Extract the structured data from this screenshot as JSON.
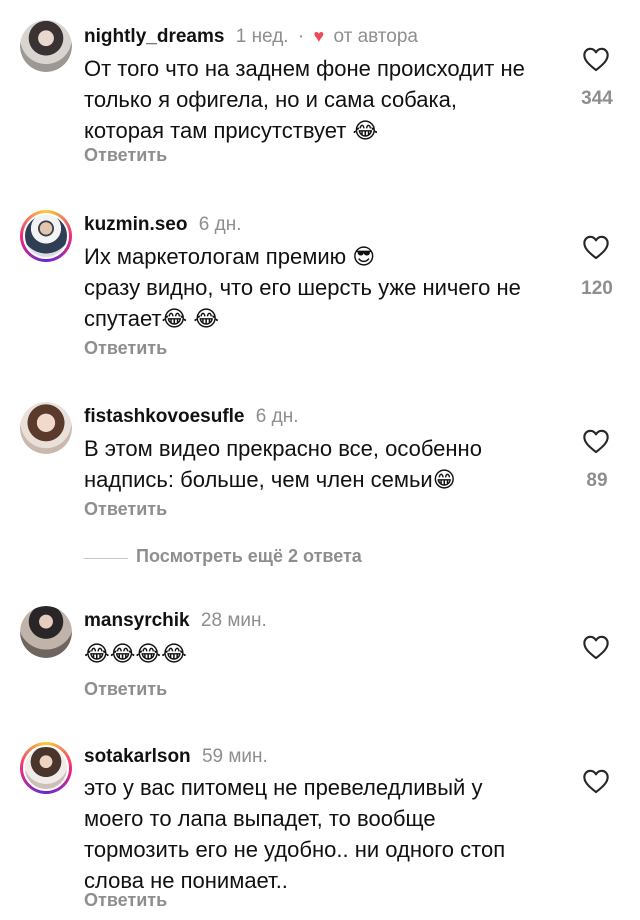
{
  "comments": [
    {
      "username": "nightly_dreams",
      "time": "1 нед.",
      "liked_by_author_label": "от автора",
      "text": "От того что на заднем фоне происходит не\nтолько я офигела, но и сама собака,\nкоторая там присутствует 😂",
      "reply_label": "Ответить",
      "likes": "344"
    },
    {
      "username": "kuzmin.seo",
      "time": "6 дн.",
      "text": "Их маркетологам премию 😎\nсразу видно, что его шерсть уже ничего не\nспутает😂 😂",
      "reply_label": "Ответить",
      "likes": "120"
    },
    {
      "username": "fistashkovoesufle",
      "time": "6 дн.",
      "text": "В этом видео прекрасно все, особенно\nнадпись: больше, чем член семьи😁",
      "reply_label": "Ответить",
      "likes": "89"
    },
    {
      "username": "mansyrchik",
      "time": "28 мин.",
      "text": "😂😂😂😂",
      "reply_label": "Ответить",
      "likes": ""
    },
    {
      "username": "sotakarlson",
      "time": "59 мин.",
      "text": "это у вас питомец не превеледливый у\nмоего то лапа выпадет, то вообще\nтормозить его не удобно.. ни одного стоп\nслова не понимает..",
      "reply_label": "Ответить",
      "likes": ""
    }
  ],
  "view_more_replies": "Посмотреть ещё 2 ответа",
  "colors": {
    "text": "#111111",
    "secondary": "#8e8e8e",
    "heart_red": "#ed4956"
  },
  "icons": {
    "like": "heart-outline-icon",
    "author_like": "heart-filled-icon"
  }
}
